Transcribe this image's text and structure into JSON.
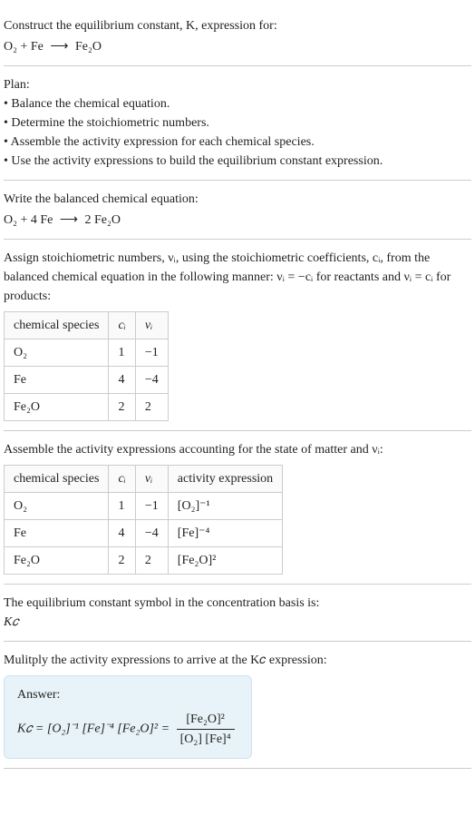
{
  "s1": {
    "line1": "Construct the equilibrium constant, K, expression for:",
    "eq_l": "O₂ + Fe",
    "eq_a": "⟶",
    "eq_r": "Fe₂O"
  },
  "s2": {
    "title": "Plan:",
    "b1": "• Balance the chemical equation.",
    "b2": "• Determine the stoichiometric numbers.",
    "b3": "• Assemble the activity expression for each chemical species.",
    "b4": "• Use the activity expressions to build the equilibrium constant expression."
  },
  "s3": {
    "line1": "Write the balanced chemical equation:",
    "eq_l": "O₂ + 4 Fe",
    "eq_a": "⟶",
    "eq_r": "2 Fe₂O"
  },
  "s4": {
    "intro": "Assign stoichiometric numbers, νᵢ, using the stoichiometric coefficients, cᵢ, from the balanced chemical equation in the following manner: νᵢ = −cᵢ for reactants and νᵢ = cᵢ for products:",
    "h1": "chemical species",
    "h2": "cᵢ",
    "h3": "νᵢ",
    "r1c1": "O₂",
    "r1c2": "1",
    "r1c3": "−1",
    "r2c1": "Fe",
    "r2c2": "4",
    "r2c3": "−4",
    "r3c1": "Fe₂O",
    "r3c2": "2",
    "r3c3": "2"
  },
  "s5": {
    "intro": "Assemble the activity expressions accounting for the state of matter and νᵢ:",
    "h1": "chemical species",
    "h2": "cᵢ",
    "h3": "νᵢ",
    "h4": "activity expression",
    "r1c1": "O₂",
    "r1c2": "1",
    "r1c3": "−1",
    "r1c4": "[O₂]⁻¹",
    "r2c1": "Fe",
    "r2c2": "4",
    "r2c3": "−4",
    "r2c4": "[Fe]⁻⁴",
    "r3c1": "Fe₂O",
    "r3c2": "2",
    "r3c3": "2",
    "r3c4": "[Fe₂O]²"
  },
  "s6": {
    "line1": "The equilibrium constant symbol in the concentration basis is:",
    "sym": "K𝑐"
  },
  "s7": {
    "line1": "Mulitply the activity expressions to arrive at the K𝑐 expression:",
    "ans_label": "Answer:",
    "lhs": "K𝑐 = [O₂]⁻¹ [Fe]⁻⁴ [Fe₂O]² =",
    "num": "[Fe₂O]²",
    "den": "[O₂] [Fe]⁴"
  },
  "chart_data": {
    "type": "table",
    "title": "Stoichiometric numbers and activity expressions",
    "columns": [
      "chemical species",
      "c_i",
      "ν_i",
      "activity expression"
    ],
    "rows": [
      {
        "species": "O2",
        "c_i": 1,
        "nu_i": -1,
        "activity": "[O2]^-1"
      },
      {
        "species": "Fe",
        "c_i": 4,
        "nu_i": -4,
        "activity": "[Fe]^-4"
      },
      {
        "species": "Fe2O",
        "c_i": 2,
        "nu_i": 2,
        "activity": "[Fe2O]^2"
      }
    ],
    "equilibrium_constant_expression": "K_c = [Fe2O]^2 / ([O2] * [Fe]^4)"
  }
}
